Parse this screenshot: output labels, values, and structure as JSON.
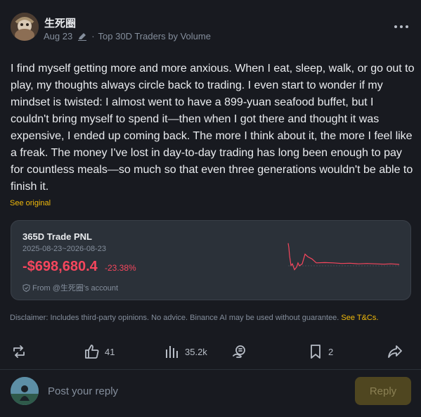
{
  "author": {
    "name": "生死圈",
    "date": "Aug 23",
    "separator": "·",
    "tag": "Top 30D Traders by Volume"
  },
  "post": {
    "text": "I find myself getting more and more anxious. When I eat, sleep, walk, or go out to play, my thoughts always circle back to trading. I even start to wonder if my mindset is twisted: I almost went to have a 899-yuan seafood buffet, but I couldn't bring myself to spend it—then when I got there and thought it was expensive, I ended up coming back. The more I think about it, the more I feel like a freak. The money I've lost in day-to-day trading has long been enough to pay for countless meals—so much so that even three generations wouldn't be able to finish it.",
    "see_original": "See original"
  },
  "pnl_card": {
    "title": "365D Trade PNL",
    "range": "2025-08-23~2026-08-23",
    "value": "-$698,680.4",
    "percent": "-23.38%",
    "from": "From @生死圈's account",
    "line_color": "#f6465d",
    "sparkline": [
      0.94,
      0.8,
      0.55,
      0.25,
      0.3,
      0.12,
      0.2,
      0.33,
      0.24,
      0.3,
      0.6,
      0.52,
      0.45,
      0.33,
      0.34,
      0.33,
      0.31,
      0.32,
      0.3,
      0.31,
      0.3,
      0.29,
      0.3,
      0.29,
      0.28
    ]
  },
  "disclaimer": {
    "text": "Disclaimer: Includes third-party opinions. No advice. Binance AI may be used without guarantee.",
    "link": "See T&Cs."
  },
  "actions": {
    "repost_icon": "repost-icon",
    "like_count": "41",
    "views_count": "35.2k",
    "tip_icon": "tip-icon",
    "bookmark_count": "2",
    "share_icon": "share-icon"
  },
  "reply": {
    "placeholder": "Post your reply",
    "button": "Reply"
  },
  "colors": {
    "accent": "#f0b90b",
    "negative": "#f6465d",
    "background": "#181a20",
    "card": "#2b3139"
  }
}
